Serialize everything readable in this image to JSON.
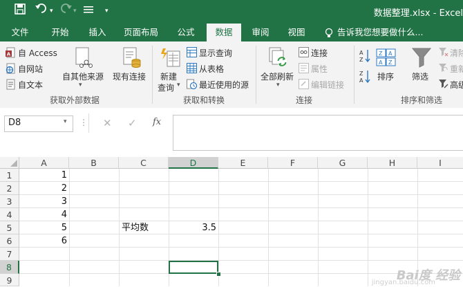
{
  "window": {
    "title": "数据整理.xlsx - Excel"
  },
  "tabs": [
    {
      "label": "文件",
      "active": false
    },
    {
      "label": "开始",
      "active": false
    },
    {
      "label": "插入",
      "active": false
    },
    {
      "label": "页面布局",
      "active": false
    },
    {
      "label": "公式",
      "active": false
    },
    {
      "label": "数据",
      "active": true
    },
    {
      "label": "审阅",
      "active": false
    },
    {
      "label": "视图",
      "active": false
    }
  ],
  "tell_me": "告诉我您想要做什么...",
  "ribbon": {
    "get_external": {
      "access": "自 Access",
      "web": "自网站",
      "text": "自文本",
      "other": "自其他来源",
      "existing": "现有连接",
      "group_label": "获取外部数据"
    },
    "get_transform": {
      "new_query_1": "新建",
      "new_query_2": "查询",
      "show_queries": "显示查询",
      "from_table": "从表格",
      "recent_sources": "最近使用的源",
      "group_label": "获取和转换"
    },
    "connections": {
      "refresh_all": "全部刷新",
      "connections": "连接",
      "properties": "属性",
      "edit_links": "编辑链接",
      "group_label": "连接"
    },
    "sort_filter": {
      "sort": "排序",
      "filter": "筛选",
      "clear": "清除",
      "reapply": "重新",
      "advanced": "高级",
      "group_label": "排序和筛选"
    }
  },
  "formula_bar": {
    "name_box": "D8",
    "fx": "fx",
    "value": ""
  },
  "columns": [
    "A",
    "B",
    "C",
    "D",
    "E",
    "F",
    "G",
    "H",
    "I"
  ],
  "rows": [
    "1",
    "2",
    "3",
    "4",
    "5",
    "6",
    "7",
    "8",
    "9"
  ],
  "cells": {
    "A1": "1",
    "A2": "2",
    "A3": "3",
    "A4": "4",
    "A5": "5",
    "A6": "6",
    "C5": "平均数",
    "D5": "3.5"
  },
  "selected_cell": "D8",
  "watermark": {
    "brand": "Bai度 经验",
    "url": "jingyan.baidu.com"
  },
  "colors": {
    "brand": "#217346",
    "ribbon_bg": "#f3f3f3"
  }
}
